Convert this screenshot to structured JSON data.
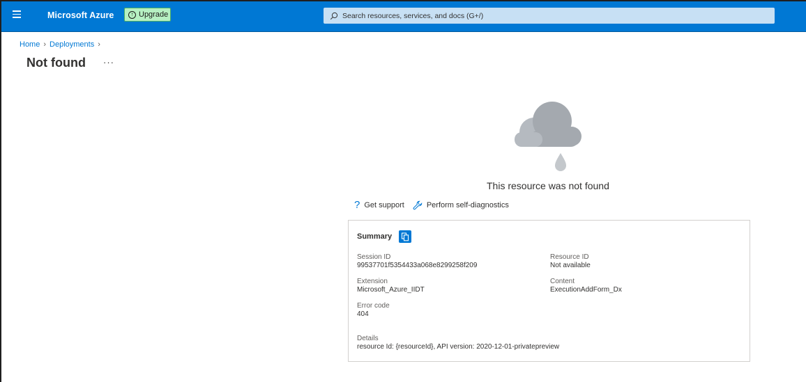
{
  "topbar": {
    "brand": "Microsoft Azure",
    "upgrade_label": "Upgrade",
    "search_placeholder": "Search resources, services, and docs (G+/)"
  },
  "breadcrumb": {
    "items": [
      "Home",
      "Deployments"
    ]
  },
  "page": {
    "title": "Not found",
    "more": "···"
  },
  "message": "This resource was not found",
  "actions": {
    "support": "Get support",
    "diagnostics": "Perform self-diagnostics"
  },
  "summary": {
    "title": "Summary",
    "session_id_label": "Session ID",
    "session_id": "99537701f5354433a068e8299258f209",
    "resource_id_label": "Resource ID",
    "resource_id": "Not available",
    "extension_label": "Extension",
    "extension": "Microsoft_Azure_IIDT",
    "content_label": "Content",
    "content": "ExecutionAddForm_Dx",
    "error_code_label": "Error code",
    "error_code": "404",
    "details_label": "Details",
    "details": "resource Id: {resourceId}, API version: 2020-12-01-privatepreview"
  },
  "colors": {
    "accent": "#0078d4",
    "upgrade_bg": "#b6f0c2",
    "search_bg": "#c7e0f4",
    "cloud": "#a9aeb4"
  }
}
